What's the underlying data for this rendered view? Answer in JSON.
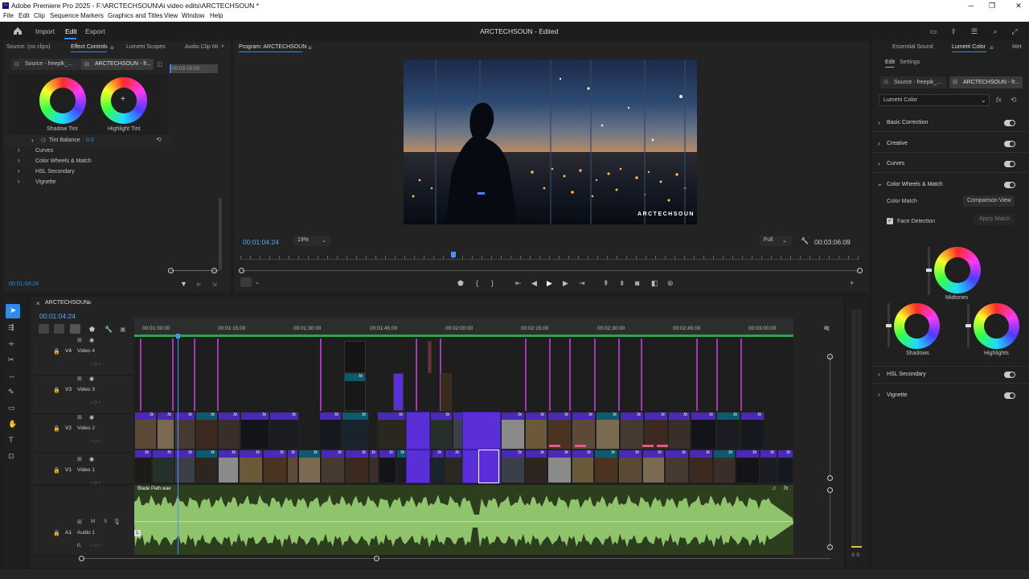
{
  "window": {
    "title": "Adobe Premiere Pro 2025 - F:\\ARCTECHSOUN\\Ai video edits\\ARCTECHSOUN *",
    "logo_text": "Pr"
  },
  "menu": [
    "File",
    "Edit",
    "Clip",
    "Sequence",
    "Markers",
    "Graphics and Titles",
    "View",
    "Window",
    "Help"
  ],
  "header": {
    "tabs": [
      "Import",
      "Edit",
      "Export"
    ],
    "active_tab": "Edit",
    "project_title": "ARCTECHSOUN - Edited"
  },
  "left_panel": {
    "tabs": [
      "Source: (no clips)",
      "Effect Controls",
      "Lumetri Scopes",
      "Audio Clip Mi"
    ],
    "clip_tabs": [
      "Source - freeplk_...",
      "ARCTECHSOUN - fr..."
    ],
    "mini_timecode": "00:03:05:00",
    "wheels": {
      "shadow": "Shadow Tint",
      "highlight": "Highlight Tint"
    },
    "tint_balance_label": "Tint Balance",
    "tint_balance_value": "0.0",
    "sections": [
      "Curves",
      "Color Wheels & Match",
      "HSL Secondary",
      "Vignette"
    ],
    "timecode": "00:01:04:24"
  },
  "program": {
    "tab": "Program: ARCTECHSOUN",
    "watermark": "ARCTECHSOUN",
    "timecode": "00:01:04:24",
    "zoom": "19%",
    "quality": "Full",
    "duration": "00:03:06:09"
  },
  "lumetri": {
    "tabs": [
      "Essential Sound",
      "Lumetri Color",
      "Met"
    ],
    "subtabs": [
      "Edit",
      "Settings"
    ],
    "clip_tabs": [
      "Source - freepik_...",
      "ARCTECHSOUN - fr..."
    ],
    "effect": "Lumetri Color",
    "sections": [
      "Basic Correction",
      "Creative",
      "Curves",
      "Color Wheels & Match"
    ],
    "color_match": "Color Match",
    "comparison_view": "Comparison View",
    "face_detection": "Face Detection",
    "apply_match": "Apply Match",
    "wheels": [
      "Midtones",
      "Shadows",
      "Highlights"
    ],
    "bottom_sections": [
      "HSL Secondary",
      "Vignette"
    ]
  },
  "timeline": {
    "sequence": "ARCTECHSOUN",
    "timecode": "00:01:04:24",
    "ruler": [
      "00:01:00:00",
      "00:01:15:00",
      "00:01:30:00",
      "00:01:45:00",
      "00:02:00:00",
      "00:02:15:00",
      "00:02:30:00",
      "00:02:45:00",
      "00:03:00:00",
      "0("
    ],
    "tracks": [
      {
        "id": "V4",
        "name": "Video 4"
      },
      {
        "id": "V3",
        "name": "Video 3"
      },
      {
        "id": "V2",
        "name": "Video 2"
      },
      {
        "id": "V1",
        "name": "Video 1"
      },
      {
        "id": "A1",
        "name": "Audio 1"
      }
    ],
    "audio_clip": "Blade Path.wav",
    "fx_label": "fx",
    "audio_labels": {
      "m": "M",
      "s": "S",
      "volume": "0,"
    },
    "meter_labels": "S S"
  },
  "colors": {
    "accent": "#2d8ceb",
    "clip_purple": "#5a2fd8",
    "fx_purple": "#4a28b8",
    "audio_green": "#8fc46d",
    "marker_magenta": "#a23ab3"
  }
}
